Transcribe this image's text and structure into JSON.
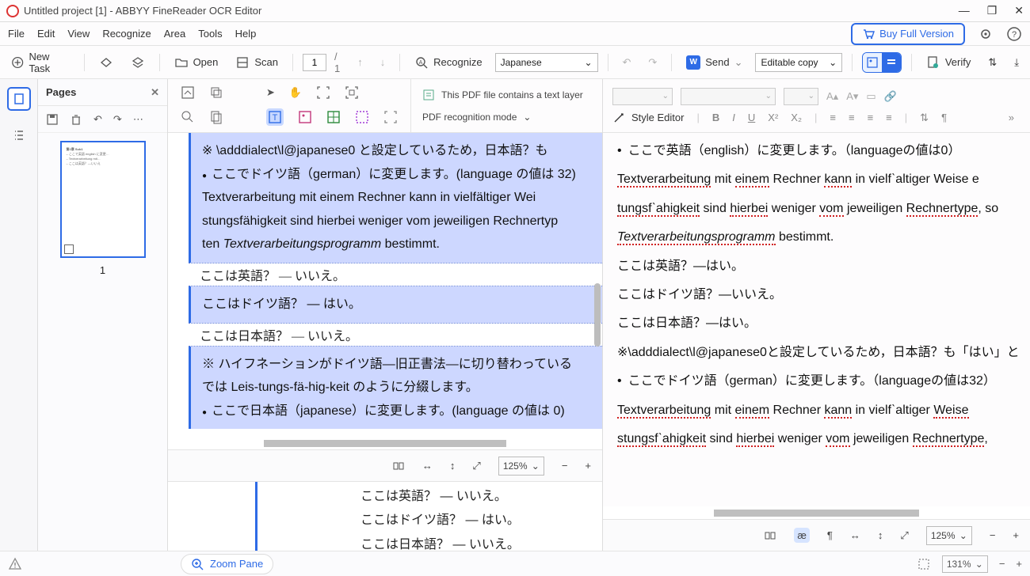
{
  "window": {
    "title": "Untitled project [1] - ABBYY FineReader OCR Editor"
  },
  "menu": [
    "File",
    "Edit",
    "View",
    "Recognize",
    "Area",
    "Tools",
    "Help"
  ],
  "menu_right": {
    "buy": "Buy Full Version"
  },
  "toolbar": {
    "newtask": "New Task",
    "open": "Open",
    "scan": "Scan",
    "page": "1",
    "pagetotal": "/ 1",
    "recognize": "Recognize",
    "language": "Japanese",
    "send": "Send",
    "copymode": "Editable copy",
    "verify": "Verify"
  },
  "pages": {
    "title": "Pages",
    "thumb_num": "1"
  },
  "centerTools": {
    "infoline": "This PDF file contains a text layer",
    "recmode": "PDF recognition mode"
  },
  "doc": {
    "l1": "※ \\adddialect\\l@japanese0 と設定しているため，日本語？も",
    "l2": "ここでドイツ語（german）に変更します。(language の値は 32)",
    "l3": "Textverarbeitung mit einem Rechner kann in vielfältiger Wei",
    "l4": "stungsfähigkeit sind hierbei weniger vom jeweiligen Rechnertyp",
    "l5_a": "ten ",
    "l5_b": "Textverarbeitungsprogramm",
    "l5_c": " bestimmt.",
    "l6": "ここは英語？ — いいえ。",
    "l7": "ここはドイツ語？ — はい。",
    "l8": "ここは日本語？ — いいえ。",
    "l9": "※ ハイフネーションがドイツ語—旧正書法—に切り替わっている",
    "l10": "では Leis-tungs-fä-hig-keit のように分綴します。",
    "l11": "ここで日本語（japanese）に変更します。(language の値は 0)"
  },
  "bottom": {
    "b1": "ここは英語？ — いいえ。",
    "b2": "ここはドイツ語？ — はい。",
    "b3": "ここは日本語？ — いいえ。"
  },
  "ctrl": {
    "zoom": "125%"
  },
  "rightTools": {
    "style": "Style Editor"
  },
  "rightDoc": {
    "r1": "ここで英語（english）に変更します。（languageの値は0）",
    "r2a": "Textverarbeitung",
    " r2b": " mit ",
    " r2c": "einem",
    " r2d": " Rechner ",
    " r2e": "kann",
    " r2f": " in vielfˋaltiger Weise e",
    "r3a": "tungsfˋahigkeit",
    " r3b": " sind ",
    " r3c": "hierbei",
    " r3d": " weniger ",
    " r3e": "vom",
    " r3f": " jeweiligen ",
    " r3g": "Rechnertype",
    ", r3h": ", so",
    "r4a": "Textverarbeitungsprogramm",
    " r4b": " bestimmt.",
    "r5": "ここは英語？—はい。",
    "r6": "ここはドイツ語？—いいえ。",
    "r7": "ここは日本語？—はい。",
    "r8": "※\\adddialect\\l@japanese0と設定しているため，日本語？も「はい」と",
    "r9": "ここでドイツ語（german）に変更します。（languageの値は32）",
    "r10a": "Textverarbeitung",
    " r10b": " mit ",
    " r10c": "einem",
    " r10d": " Rechner ",
    " r10e": "kann",
    " r10f": " in vielfˋaltiger ",
    " r10g": "Weise",
    "r11a": "stungsfˋahigkeit",
    " r11b": " sind ",
    " r11c": "hierbei",
    " r11d": " weniger ",
    " r11e": "vom",
    " r11f": " jeweiligen ",
    " r11g": "Rechnertype",
    ", r11h": ","
  },
  "rightCtrl": {
    "zoom": "125%"
  },
  "footer": {
    "zoompane": "Zoom Pane",
    "zoom": "131%"
  }
}
